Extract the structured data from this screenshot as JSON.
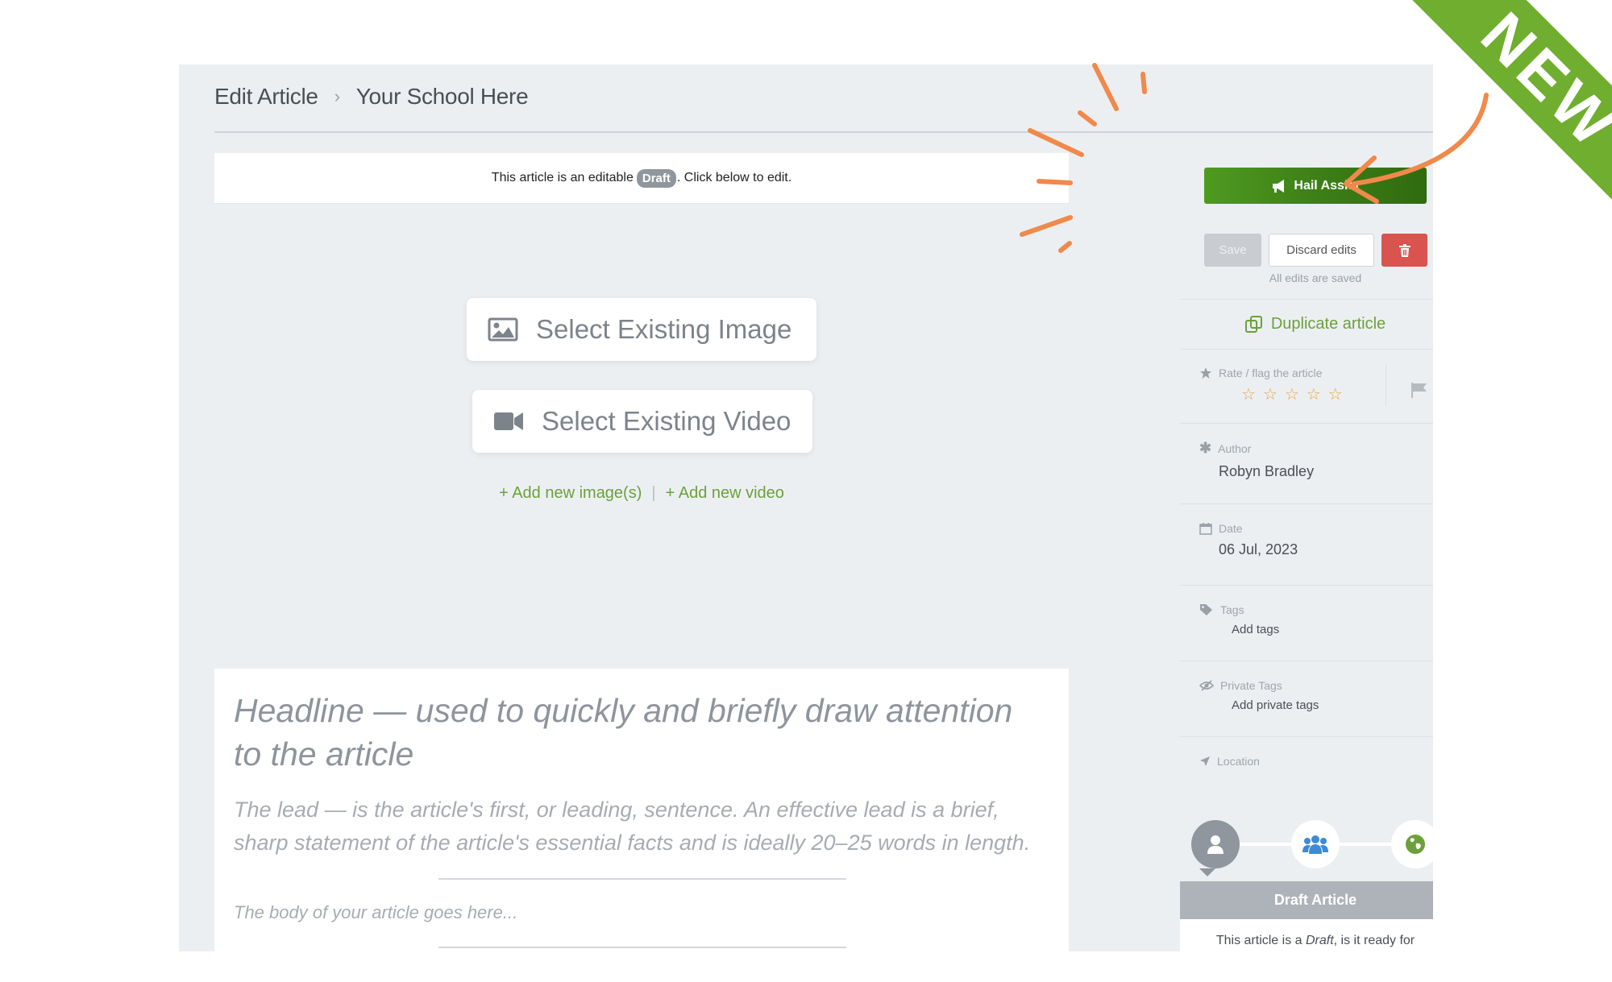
{
  "breadcrumb": {
    "root": "Edit Article",
    "separator": "›",
    "current": "Your School Here"
  },
  "draft_notice": {
    "before": "This article is an editable",
    "pill": "Draft",
    "after": ". Click below to edit."
  },
  "media": {
    "select_image": "Select Existing Image",
    "select_video": "Select Existing Video",
    "add_image": "+ Add new image(s)",
    "add_video": "+ Add new video",
    "divider": "|"
  },
  "article": {
    "headline": "Headline — used to quickly and briefly draw attention to the article",
    "lead": "The lead — is the article's first, or leading, sentence. An effective lead is a brief, sharp statement of the article's essential facts and is ideally 20–25 words in length.",
    "body": "The body of your article goes here..."
  },
  "sidebar": {
    "hail_assist": "Hail Assist",
    "save": "Save",
    "discard": "Discard edits",
    "saved_note": "All edits are saved",
    "duplicate": "Duplicate article",
    "rate_label": "Rate / flag the article",
    "rating": {
      "value": 0,
      "max": 5
    },
    "author_label": "Author",
    "author": "Robyn Bradley",
    "date_label": "Date",
    "date": "06 Jul, 2023",
    "tags_label": "Tags",
    "tags_action": "Add tags",
    "private_tags_label": "Private Tags",
    "private_tags_action": "Add private tags",
    "location_label": "Location"
  },
  "workflow": {
    "stages": [
      "person-icon",
      "group-icon",
      "globe-icon"
    ],
    "title": "Draft Article",
    "body_before": "This article is a ",
    "body_em": "Draft",
    "body_after": ", is it ready for"
  },
  "ribbon": {
    "label": "NEW"
  },
  "colors": {
    "accent_green": "#6ba13a",
    "hail_green": "#3c7d16",
    "ribbon_green": "#6fae2e",
    "arrow_orange": "#f0894a",
    "delete_red": "#d9534f",
    "star_orange": "#e8a33c"
  }
}
